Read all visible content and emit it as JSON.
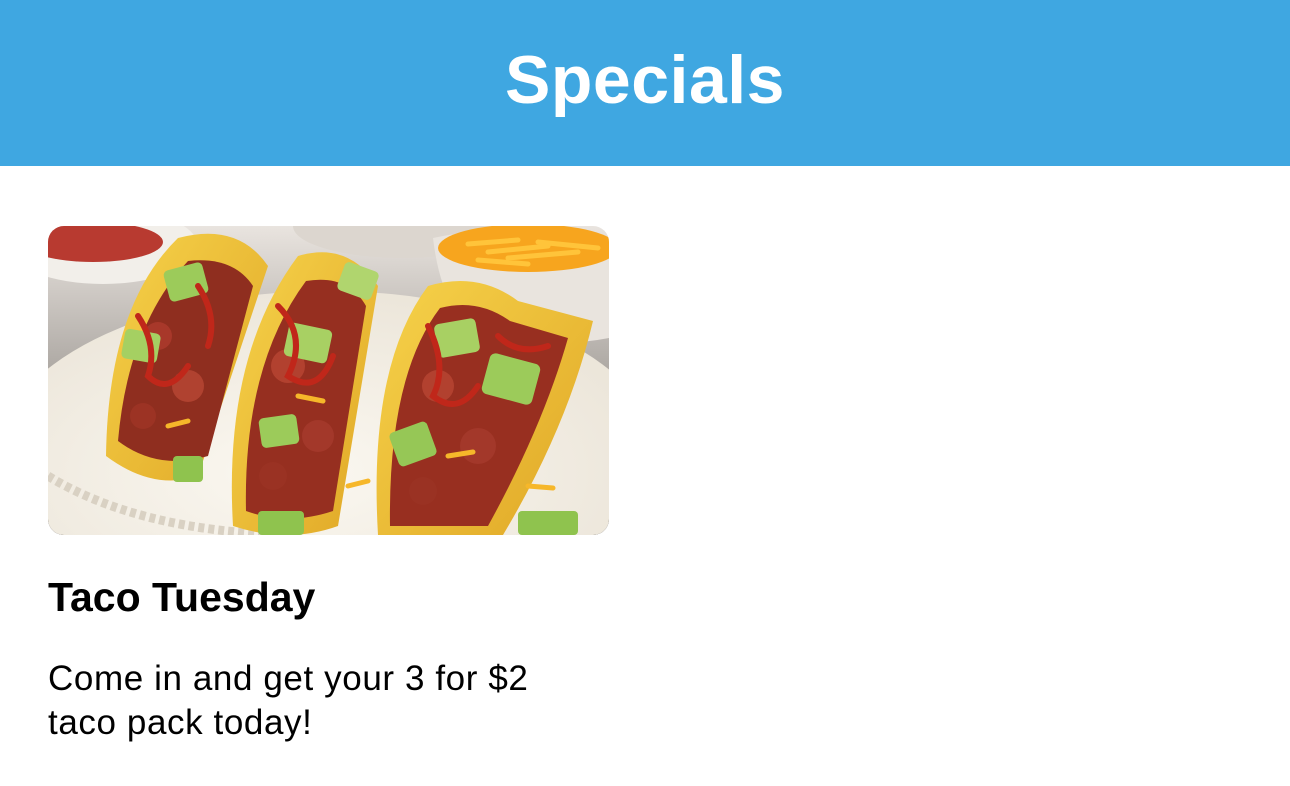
{
  "header": {
    "title": "Specials",
    "background_color": "#3fa7e1"
  },
  "specials": [
    {
      "image": "tacos-photo",
      "title": "Taco Tuesday",
      "description": "Come in and get your 3 for $2 taco pack today!"
    }
  ]
}
